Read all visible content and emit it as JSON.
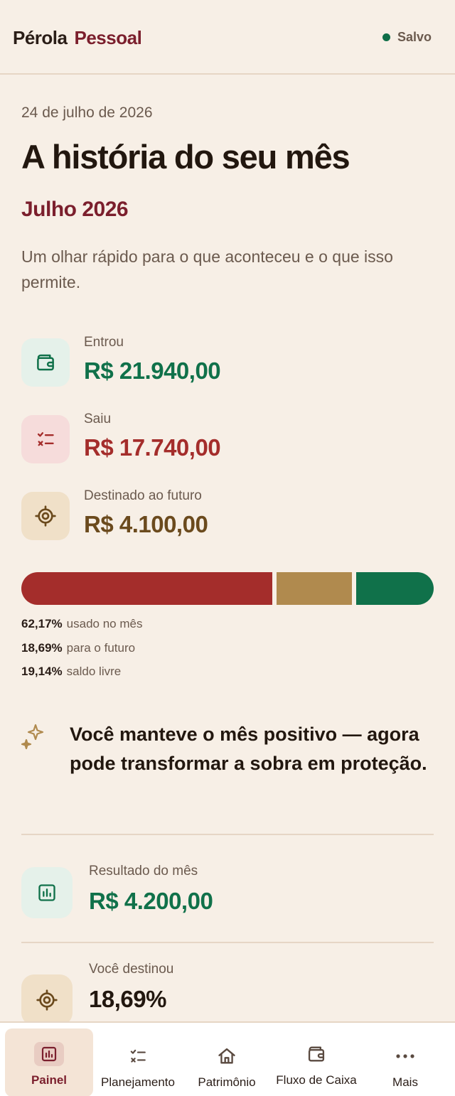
{
  "header": {
    "brand_first": "Pérola",
    "brand_second": "Pessoal",
    "status": "Salvo"
  },
  "summary": {
    "date": "24 de julho de 2026",
    "title": "A história do seu mês",
    "month": "Julho 2026",
    "subtitle": "Um olhar rápido para o que aconteceu e o que isso permite."
  },
  "stats": [
    {
      "label": "Entrou",
      "value": "R$ 21.940,00",
      "icon": "wallet-icon",
      "color": "#10714a",
      "bg": "#e5f1ea"
    },
    {
      "label": "Saiu",
      "value": "R$ 17.740,00",
      "icon": "checklist-icon",
      "color": "#a42d2b",
      "bg": "#f6dcdb"
    },
    {
      "label": "Destinado ao futuro",
      "value": "R$ 4.100,00",
      "icon": "target-icon",
      "color": "#6b4a1d",
      "bg": "#f0e0c8"
    }
  ],
  "distribution": [
    {
      "pct": "62,17%",
      "label": "usado no mês",
      "fraction": 0.6217,
      "color": "#a42d2b"
    },
    {
      "pct": "18,69%",
      "label": "para o futuro",
      "fraction": 0.1869,
      "color": "#b08a4e"
    },
    {
      "pct": "19,14%",
      "label": "saldo livre",
      "fraction": 0.1914,
      "color": "#10714a"
    }
  ],
  "insight": {
    "icon": "sparkle-icon",
    "text": "Você manteve o mês positivo — agora pode transformar a sobra em proteção."
  },
  "details": [
    {
      "label": "Resultado do mês",
      "value": "R$ 4.200,00",
      "icon": "bar-chart-icon",
      "color": "#10714a",
      "bg": "#e5f1ea"
    },
    {
      "label": "Você destinou",
      "value": "18,69%",
      "icon": "target-icon",
      "color": "#22170f",
      "bg": "#f0e0c8"
    }
  ],
  "nav": [
    {
      "label": "Painel",
      "icon": "bar-chart-icon",
      "active": true
    },
    {
      "label": "Planejamento",
      "icon": "checklist-icon",
      "active": false
    },
    {
      "label": "Patrimônio",
      "icon": "home-icon",
      "active": false
    },
    {
      "label": "Fluxo de Caixa",
      "icon": "wallet-icon",
      "active": false
    },
    {
      "label": "Mais",
      "icon": "more-icon",
      "active": false
    }
  ]
}
